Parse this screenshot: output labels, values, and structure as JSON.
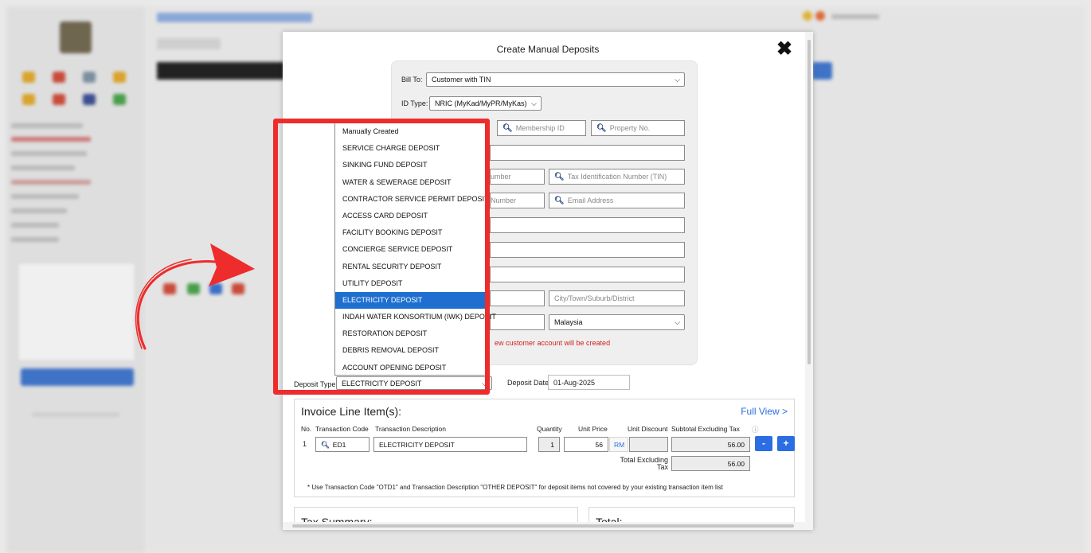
{
  "modal": {
    "title": "Create Manual Deposits",
    "close_glyph": "✖"
  },
  "form": {
    "bill_to_label": "Bill To:",
    "bill_to_value": "Customer with TIN",
    "id_type_label": "ID Type:",
    "id_type_value": "NRIC (MyKad/MyPR/MyKas)",
    "membership_id_placeholder": "Membership ID",
    "property_no_placeholder": "Property No.",
    "partial_number_1": "umber",
    "tin_placeholder": "Tax Identification Number (TIN)",
    "partial_number_2": "Number",
    "email_placeholder": "Email Address",
    "city_placeholder": "City/Town/Suburb/District",
    "country_value": "Malaysia",
    "notice_text": "ew customer account will be created",
    "deposit_type_label": "Deposit Type",
    "deposit_type_value": "ELECTRICITY DEPOSIT",
    "deposit_date_label": "Deposit Date",
    "deposit_date_value": "01-Aug-2025"
  },
  "dropdown": {
    "items": [
      "Manually Created",
      "SERVICE CHARGE DEPOSIT",
      "SINKING FUND DEPOSIT",
      "WATER & SEWERAGE DEPOSIT",
      "CONTRACTOR SERVICE PERMIT DEPOSIT",
      "ACCESS CARD DEPOSIT",
      "FACILITY BOOKING DEPOSIT",
      "CONCIERGE SERVICE DEPOSIT",
      "RENTAL SECURITY DEPOSIT",
      "UTILITY DEPOSIT",
      "ELECTRICITY DEPOSIT",
      "INDAH WATER KONSORTIUM (IWK) DEPOSIT",
      "RESTORATION DEPOSIT",
      "DEBRIS REMOVAL DEPOSIT",
      "ACCOUNT OPENING DEPOSIT"
    ],
    "selected": "ELECTRICITY DEPOSIT"
  },
  "invoice": {
    "title": "Invoice Line Item(s):",
    "full_view": "Full View >",
    "columns": {
      "no": "No.",
      "code": "Transaction Code",
      "desc": "Transaction Description",
      "qty": "Quantity",
      "price": "Unit Price",
      "discount": "Unit Discount",
      "subtotal": "Subtotal Excluding Tax"
    },
    "row": {
      "no": "1",
      "code": "ED1",
      "desc": "ELECTRICITY DEPOSIT",
      "qty": "1",
      "price": "56",
      "currency": "RM",
      "discount": "",
      "subtotal": "56.00"
    },
    "total_excl_label_line1": "Total Excluding",
    "total_excl_label_line2": "Tax",
    "total_excl_value": "56.00",
    "minus": "-",
    "plus": "+",
    "footnote": "* Use Transaction Code \"OTD1\" and Transaction Description \"OTHER DEPOSIT\" for deposit items not covered by your existing transaction item list"
  },
  "summary": {
    "tax_title": "Tax Summary:",
    "total_title": "Total:"
  },
  "annotation": {
    "color": "#ee2c2c"
  }
}
